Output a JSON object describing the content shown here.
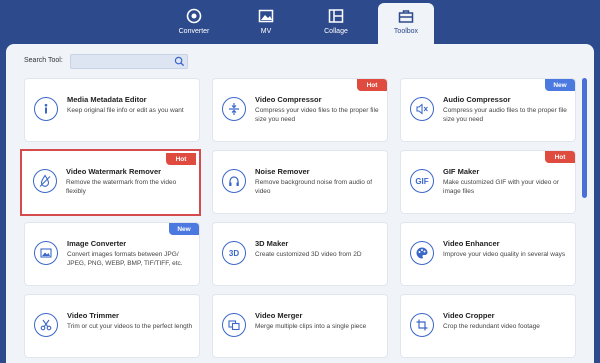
{
  "nav": {
    "tabs": [
      {
        "label": "Converter",
        "icon": "converter-icon"
      },
      {
        "label": "MV",
        "icon": "mv-icon"
      },
      {
        "label": "Collage",
        "icon": "collage-icon"
      },
      {
        "label": "Toolbox",
        "icon": "toolbox-icon",
        "active": true
      }
    ]
  },
  "search": {
    "label": "Search Tool:",
    "value": "",
    "placeholder": ""
  },
  "colors": {
    "accent": "#2d4a8c",
    "hot": "#e04b3f",
    "new": "#4b79e0",
    "selected_border": "#d54a4a"
  },
  "tools": [
    {
      "title": "Media Metadata Editor",
      "desc": "Keep original file info or edit as you want",
      "icon": "info-icon"
    },
    {
      "title": "Video Compressor",
      "desc": "Compress your video files to the proper file size you need",
      "icon": "compress-icon",
      "badge": "Hot"
    },
    {
      "title": "Audio Compressor",
      "desc": "Compress your audio files to the proper file size you need",
      "icon": "audio-compress-icon",
      "badge": "New"
    },
    {
      "title": "Video Watermark Remover",
      "desc": "Remove the watermark from the video flexibly",
      "icon": "watermark-icon",
      "badge": "Hot",
      "selected": true
    },
    {
      "title": "Noise Remover",
      "desc": "Remove background noise from audio of video",
      "icon": "noise-icon"
    },
    {
      "title": "GIF Maker",
      "desc": "Make customized GIF with your video or image files",
      "icon": "gif-icon",
      "icon_text": "GIF",
      "badge": "Hot"
    },
    {
      "title": "Image Converter",
      "desc": "Convert images formats between JPG/ JPEG, PNG, WEBP, BMP, TIF/TIFF, etc.",
      "icon": "image-convert-icon",
      "badge": "New"
    },
    {
      "title": "3D Maker",
      "desc": "Create customized 3D video from 2D",
      "icon": "3d-icon",
      "icon_text": "3D"
    },
    {
      "title": "Video Enhancer",
      "desc": "Improve your video quality in several ways",
      "icon": "palette-icon"
    },
    {
      "title": "Video Trimmer",
      "desc": "Trim or cut your videos to the perfect length",
      "icon": "scissors-icon"
    },
    {
      "title": "Video Merger",
      "desc": "Merge multiple clips into a single piece",
      "icon": "merge-icon"
    },
    {
      "title": "Video Cropper",
      "desc": "Crop the redundant video footage",
      "icon": "crop-icon"
    }
  ]
}
